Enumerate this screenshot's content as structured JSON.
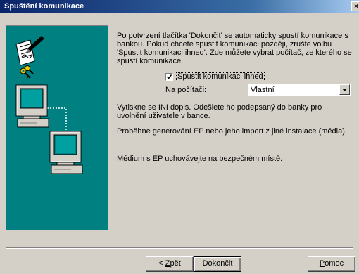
{
  "window": {
    "title": "Spuštění komunikace",
    "close_glyph": "×"
  },
  "content": {
    "intro": "Po potvrzení tlačítka 'Dokončit' se automaticky spustí komunikace s bankou. Pokud chcete spustit komunikaci později, zrušte volbu 'Spustit komunikaci ihned'. Zde můžete vybrat počítač, ze kterého se spustí komunikace.",
    "checkbox_label": "Spustit komunikaci ihned",
    "checkbox_checked": true,
    "computer_label": "Na počítači:",
    "computer_value": "Vlastní",
    "info_ini": "Vytiskne se INI dopis. Odešlete ho podepsaný do banky pro uvolnění uživatele v bance.",
    "info_ep": "Proběhne generování EP nebo jeho import z jiné instalace (média).",
    "info_media": "Médium s EP uchovávejte na bezpečném místě."
  },
  "buttons": {
    "back_prefix": "< ",
    "back_mnemonic": "Z",
    "back_rest": "pět",
    "finish": "Dokončit",
    "help_mnemonic": "P",
    "help_rest": "omoc"
  },
  "icons": [
    "pen-document-icon",
    "keys-icon",
    "computer-icon",
    "computer-icon",
    "network-connection-icon"
  ]
}
